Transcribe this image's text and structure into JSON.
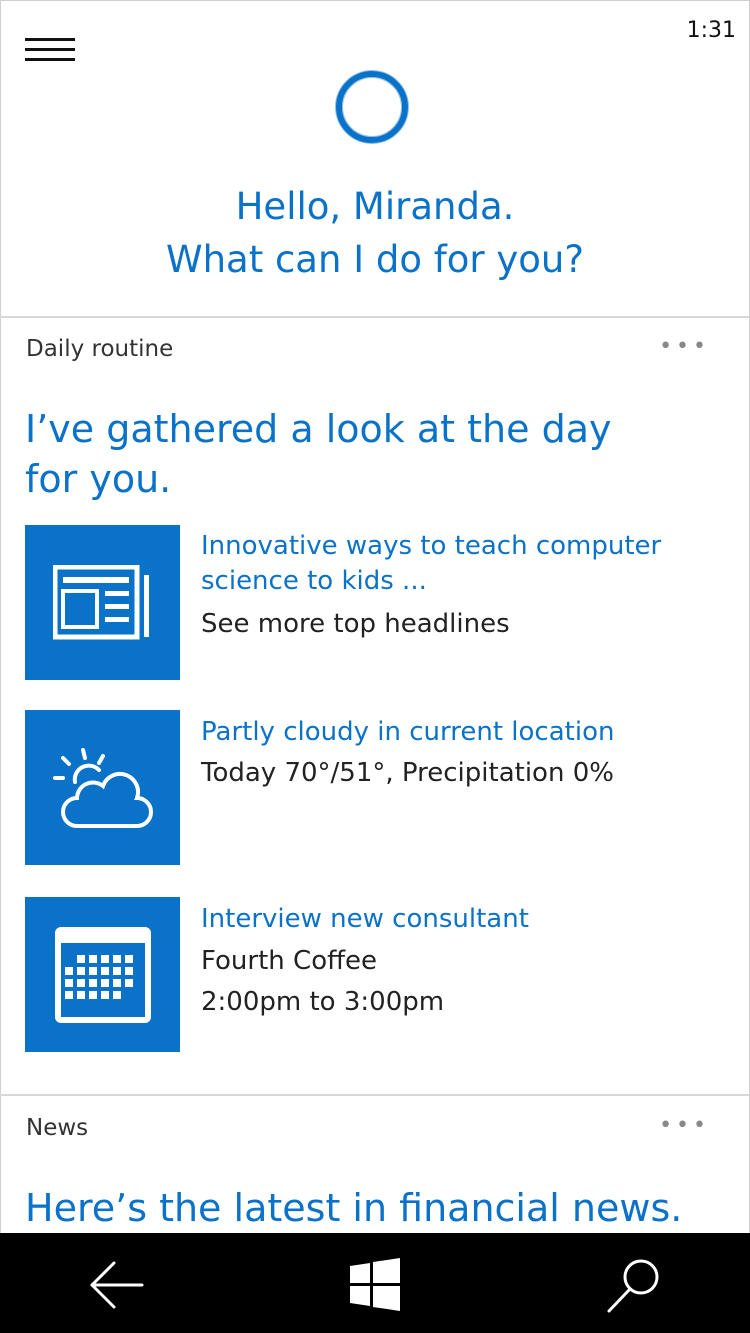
{
  "status_bar": {
    "time": "1:31"
  },
  "header": {
    "greeting_line1": "Hello, Miranda.",
    "greeting_line2": "What can I do for you?"
  },
  "daily_routine": {
    "label": "Daily routine",
    "more": "•••",
    "headline": "I’ve gathered a look at the day for you.",
    "items": [
      {
        "icon": "news-icon",
        "title": "Innovative ways to teach computer science to kids ...",
        "lines": [
          "See more top headlines"
        ]
      },
      {
        "icon": "weather-partly-cloudy-icon",
        "title": "Partly cloudy in current location",
        "lines": [
          "Today 70°/51°, Precipitation 0%"
        ]
      },
      {
        "icon": "calendar-icon",
        "title": "Interview new consultant",
        "lines": [
          "Fourth Coffee",
          "2:00pm to 3:00pm"
        ]
      }
    ]
  },
  "news": {
    "label": "News",
    "more": "•••",
    "headline": "Here’s the latest in financial news."
  },
  "navbar": {
    "back_icon": "back-arrow-icon",
    "home_icon": "windows-logo-icon",
    "search_icon": "search-icon"
  },
  "colors": {
    "accent": "#0a72c9",
    "navbar": "#000000",
    "separator": "#d8d8d8"
  }
}
